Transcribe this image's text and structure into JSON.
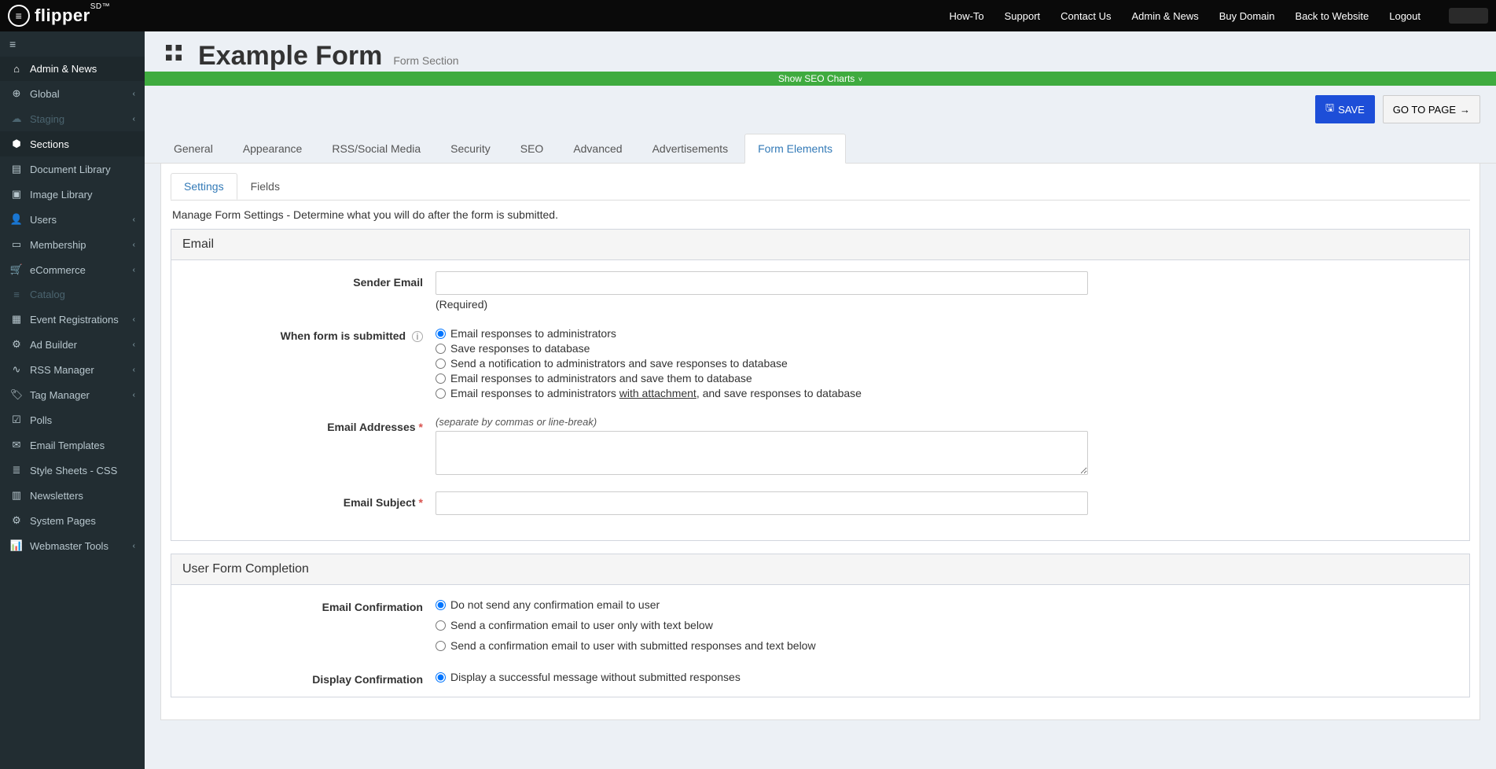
{
  "topnav": {
    "items": [
      "How-To",
      "Support",
      "Contact Us",
      "Admin & News",
      "Buy Domain",
      "Back to Website",
      "Logout"
    ]
  },
  "logo": {
    "text": "flipper",
    "sup": "SD™"
  },
  "sidebar": {
    "items": [
      {
        "icon": "home",
        "label": "Admin & News",
        "chev": false,
        "active": true
      },
      {
        "icon": "globe",
        "label": "Global",
        "chev": true
      },
      {
        "icon": "cloud",
        "label": "Staging",
        "chev": true,
        "disabled": true
      },
      {
        "icon": "cubes",
        "label": "Sections",
        "chev": false,
        "active": true
      },
      {
        "icon": "file",
        "label": "Document Library",
        "chev": false
      },
      {
        "icon": "image",
        "label": "Image Library",
        "chev": false
      },
      {
        "icon": "user",
        "label": "Users",
        "chev": true
      },
      {
        "icon": "id",
        "label": "Membership",
        "chev": true
      },
      {
        "icon": "cart",
        "label": "eCommerce",
        "chev": true
      },
      {
        "icon": "list",
        "label": "Catalog",
        "chev": false,
        "disabled": true
      },
      {
        "icon": "calendar",
        "label": "Event Registrations",
        "chev": true
      },
      {
        "icon": "cogs",
        "label": "Ad Builder",
        "chev": true
      },
      {
        "icon": "rss",
        "label": "RSS Manager",
        "chev": true
      },
      {
        "icon": "tag",
        "label": "Tag Manager",
        "chev": true
      },
      {
        "icon": "check",
        "label": "Polls",
        "chev": false
      },
      {
        "icon": "mail",
        "label": "Email Templates",
        "chev": false
      },
      {
        "icon": "stack",
        "label": "Style Sheets - CSS",
        "chev": false
      },
      {
        "icon": "news",
        "label": "Newsletters",
        "chev": false
      },
      {
        "icon": "gear",
        "label": "System Pages",
        "chev": false
      },
      {
        "icon": "chart",
        "label": "Webmaster Tools",
        "chev": true
      }
    ]
  },
  "page": {
    "title": "Example Form",
    "subtitle": "Form Section",
    "seo_bar": "Show SEO Charts"
  },
  "actions": {
    "save": "SAVE",
    "goto": "GO TO PAGE"
  },
  "tabs": [
    "General",
    "Appearance",
    "RSS/Social Media",
    "Security",
    "SEO",
    "Advanced",
    "Advertisements",
    "Form Elements"
  ],
  "active_tab": "Form Elements",
  "subtabs": [
    "Settings",
    "Fields"
  ],
  "active_subtab": "Settings",
  "description": "Manage Form Settings - Determine what you will do after the form is submitted.",
  "email_card": {
    "title": "Email",
    "sender_label": "Sender Email",
    "sender_helper": "(Required)",
    "when_label": "When form is submitted",
    "options": [
      "Email responses to administrators",
      "Save responses to database",
      "Send a notification to administrators and save responses to database",
      "Email responses to administrators and save them to database"
    ],
    "option5_pre": "Email responses to administrators ",
    "option5_mid": "with attachment",
    "option5_post": ", and save responses to database",
    "addresses_label": "Email Addresses",
    "addresses_helper": "(separate by commas or line-break)",
    "subject_label": "Email Subject"
  },
  "completion_card": {
    "title": "User Form Completion",
    "email_conf_label": "Email Confirmation",
    "email_conf_options": [
      "Do not send any confirmation email to user",
      "Send a confirmation email to user only with text below",
      "Send a confirmation email to user with submitted responses and text below"
    ],
    "display_conf_label": "Display Confirmation",
    "display_conf_option1": "Display a successful message without submitted responses"
  },
  "icons": {
    "home": "⌂",
    "globe": "⊕",
    "cloud": "☁",
    "cubes": "⬢",
    "file": "▤",
    "image": "▣",
    "user": "👤",
    "id": "▭",
    "cart": "🛒",
    "list": "≡",
    "calendar": "▦",
    "cogs": "⚙",
    "rss": "∿",
    "tag": "🏷",
    "check": "☑",
    "mail": "✉",
    "stack": "≣",
    "news": "▥",
    "gear": "⚙",
    "chart": "📊"
  }
}
